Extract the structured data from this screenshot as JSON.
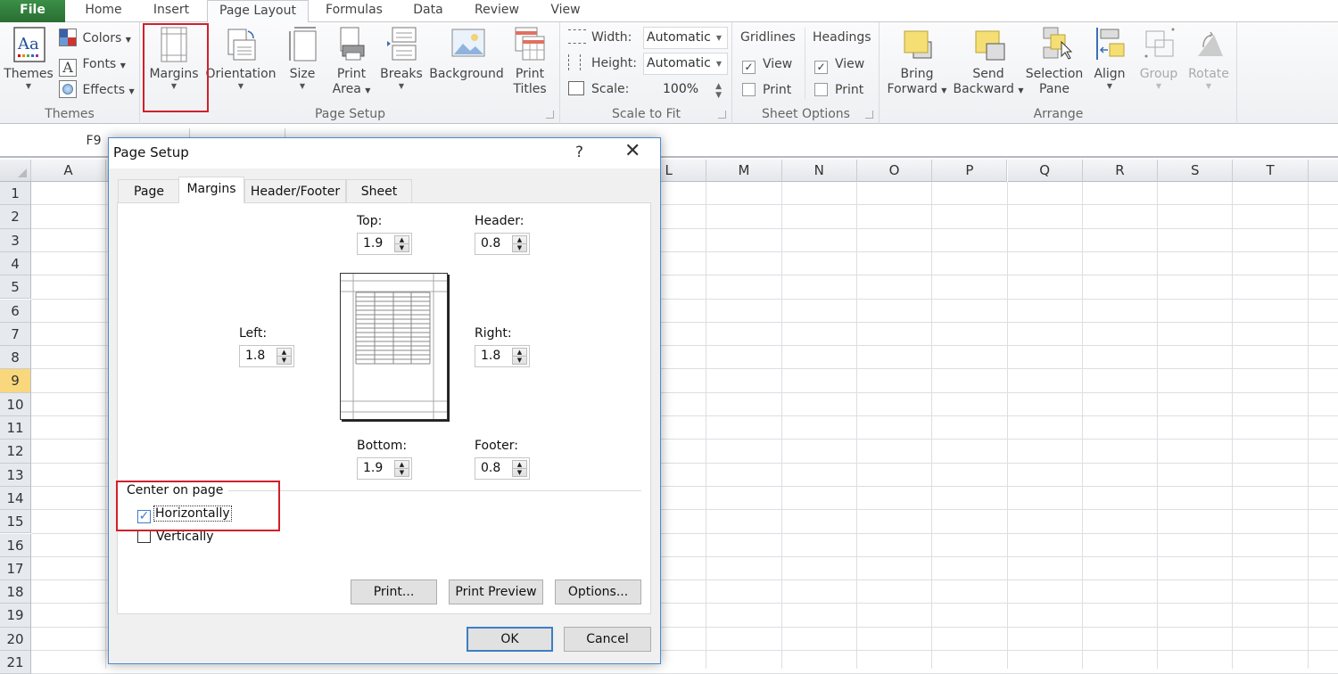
{
  "ribbon_tabs": [
    {
      "label": "File"
    },
    {
      "label": "Home"
    },
    {
      "label": "Insert"
    },
    {
      "label": "Page Layout",
      "active": true
    },
    {
      "label": "Formulas"
    },
    {
      "label": "Data"
    },
    {
      "label": "Review"
    },
    {
      "label": "View"
    }
  ],
  "ribbon": {
    "themes_group": {
      "label": "Themes",
      "themes_button": "Themes",
      "colors": "Colors",
      "fonts": "Fonts",
      "effects": "Effects"
    },
    "page_setup_group": {
      "label": "Page Setup",
      "margins": "Margins",
      "orientation": "Orientation",
      "size": "Size",
      "print_area_line1": "Print",
      "print_area_line2": "Area",
      "breaks": "Breaks",
      "background": "Background",
      "print_titles_line1": "Print",
      "print_titles_line2": "Titles"
    },
    "scale_group": {
      "label": "Scale to Fit",
      "width_label": "Width:",
      "width_value": "Automatic",
      "height_label": "Height:",
      "height_value": "Automatic",
      "scale_label": "Scale:",
      "scale_value": "100%"
    },
    "sheet_options_group": {
      "label": "Sheet Options",
      "gridlines": "Gridlines",
      "headings": "Headings",
      "gridlines_view": "View",
      "gridlines_print": "Print",
      "headings_view": "View",
      "headings_print": "Print",
      "gridlines_view_checked": true,
      "gridlines_print_checked": false,
      "headings_view_checked": true,
      "headings_print_checked": false
    },
    "arrange_group": {
      "label": "Arrange",
      "bring_forward_line1": "Bring",
      "bring_forward_line2": "Forward",
      "send_backward_line1": "Send",
      "send_backward_line2": "Backward",
      "selection_pane_line1": "Selection",
      "selection_pane_line2": "Pane",
      "align": "Align",
      "group": "Group",
      "rotate": "Rotate"
    }
  },
  "formula_bar": {
    "name_box": "F9"
  },
  "grid": {
    "columns_left": [
      "A"
    ],
    "columns_right": [
      "L",
      "M",
      "N",
      "O",
      "P",
      "Q",
      "R",
      "S",
      "T"
    ],
    "rows": [
      "1",
      "2",
      "3",
      "4",
      "5",
      "6",
      "7",
      "8",
      "9",
      "10",
      "11",
      "12",
      "13",
      "14",
      "15",
      "16",
      "17",
      "18",
      "19",
      "20",
      "21"
    ],
    "selected_row": "9"
  },
  "dialog": {
    "title": "Page Setup",
    "help": "?",
    "close": "✕",
    "tabs": [
      "Page",
      "Margins",
      "Header/Footer",
      "Sheet"
    ],
    "active_tab": "Margins",
    "fields": {
      "top": {
        "label": "Top:",
        "value": "1.9"
      },
      "header": {
        "label": "Header:",
        "value": "0.8"
      },
      "left": {
        "label": "Left:",
        "value": "1.8"
      },
      "right": {
        "label": "Right:",
        "value": "1.8"
      },
      "bottom": {
        "label": "Bottom:",
        "value": "1.9"
      },
      "footer": {
        "label": "Footer:",
        "value": "0.8"
      }
    },
    "center_on_page": {
      "legend": "Center on page",
      "horizontally": "Horizontally",
      "horizontally_checked": true,
      "vertically": "Vertically",
      "vertically_checked": false
    },
    "buttons": {
      "print": "Print...",
      "print_preview": "Print Preview",
      "options": "Options...",
      "ok": "OK",
      "cancel": "Cancel"
    }
  },
  "colors": {
    "highlight_red": "#d0202a",
    "file_tab_green": "#2d7a3a",
    "selected_row_header": "#f9d77c",
    "dialog_border": "#4a8ad0"
  }
}
